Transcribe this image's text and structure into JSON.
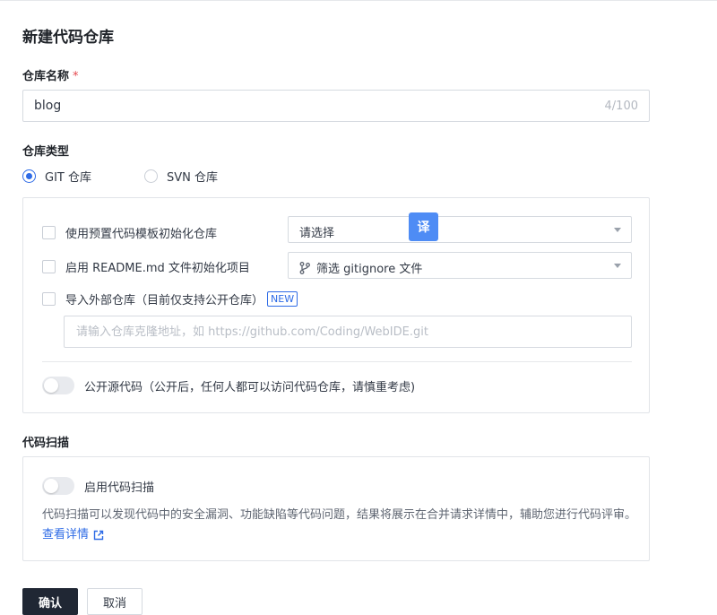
{
  "page": {
    "title": "新建代码仓库"
  },
  "repo_name": {
    "label": "仓库名称",
    "required_mark": "*",
    "value": "blog",
    "counter": "4/100"
  },
  "repo_type": {
    "label": "仓库类型",
    "options": [
      {
        "label": "GIT 仓库",
        "selected": true
      },
      {
        "label": "SVN 仓库",
        "selected": false
      }
    ]
  },
  "git_options": {
    "template": {
      "label": "使用预置代码模板初始化仓库",
      "select_value": "请选择"
    },
    "readme": {
      "label": "启用 README.md 文件初始化项目",
      "select_value": "筛选 gitignore 文件"
    },
    "import": {
      "label": "导入外部仓库（目前仅支持公开仓库）",
      "badge": "NEW",
      "placeholder": "请输入仓库克隆地址，如 https://github.com/Coding/WebIDE.git"
    },
    "public": {
      "label": "公开源代码（公开后，任何人都可以访问代码仓库，请慎重考虑)"
    }
  },
  "translate_button": {
    "label": "译"
  },
  "code_scan": {
    "label": "代码扫描",
    "toggle_label": "启用代码扫描",
    "description": "代码扫描可以发现代码中的安全漏洞、功能缺陷等代码问题，结果将展示在合并请求详情中，辅助您进行代码评审。",
    "link_label": "查看详情"
  },
  "actions": {
    "confirm": "确认",
    "cancel": "取消"
  },
  "colors": {
    "accent": "#2e6be6",
    "primary_button": "#202734",
    "required": "#e5484d"
  },
  "icons": {
    "branch": "git-branch-icon",
    "external": "external-link-icon",
    "caret": "chevron-down-icon"
  }
}
